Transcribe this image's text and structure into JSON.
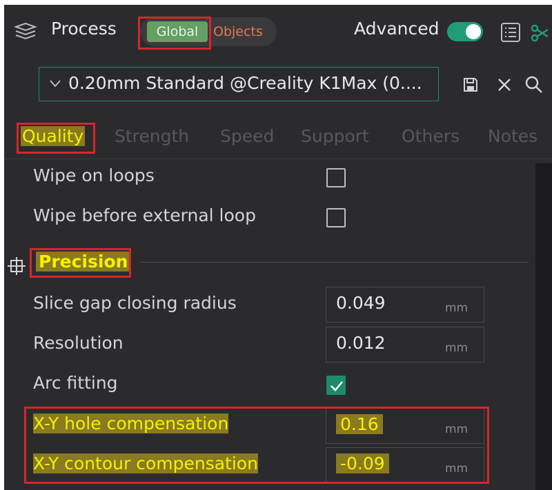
{
  "header": {
    "title": "Process",
    "segment_global": "Global",
    "segment_objects": "Objects",
    "advanced_label": "Advanced",
    "advanced_on": true
  },
  "preset": {
    "name": "0.20mm Standard @Creality K1Max (0...."
  },
  "tabs": [
    {
      "label": "Quality",
      "active": true
    },
    {
      "label": "Strength",
      "active": false
    },
    {
      "label": "Speed",
      "active": false
    },
    {
      "label": "Support",
      "active": false
    },
    {
      "label": "Others",
      "active": false
    },
    {
      "label": "Notes",
      "active": false
    }
  ],
  "settings": {
    "wipe_on_loops": {
      "label": "Wipe on loops",
      "checked": false
    },
    "wipe_before_external_loop": {
      "label": "Wipe before external loop",
      "checked": false
    },
    "precision_title": "Precision",
    "slice_gap_closing_radius": {
      "label": "Slice gap closing radius",
      "value": "0.049",
      "unit": "mm"
    },
    "resolution": {
      "label": "Resolution",
      "value": "0.012",
      "unit": "mm"
    },
    "arc_fitting": {
      "label": "Arc fitting",
      "checked": true
    },
    "xy_hole_compensation": {
      "label": "X-Y hole compensation",
      "value": "0.16",
      "unit": "mm"
    },
    "xy_contour_compensation": {
      "label": "X-Y contour compensation",
      "value": "-0.09",
      "unit": "mm"
    }
  },
  "colors": {
    "accent": "#1f9e75",
    "highlight": "#8a7a20",
    "annotation_box": "#d6262a",
    "global_segment": "#62a064",
    "objects_text": "#e47a4a"
  },
  "icons": {
    "process": "layers-icon",
    "list": "list-icon",
    "scissor": "scissor-icon",
    "save": "save-icon",
    "close": "close-icon",
    "search": "search-icon",
    "precision": "crosshair-icon",
    "chevron": "chevron-down-icon",
    "check": "check-icon"
  }
}
